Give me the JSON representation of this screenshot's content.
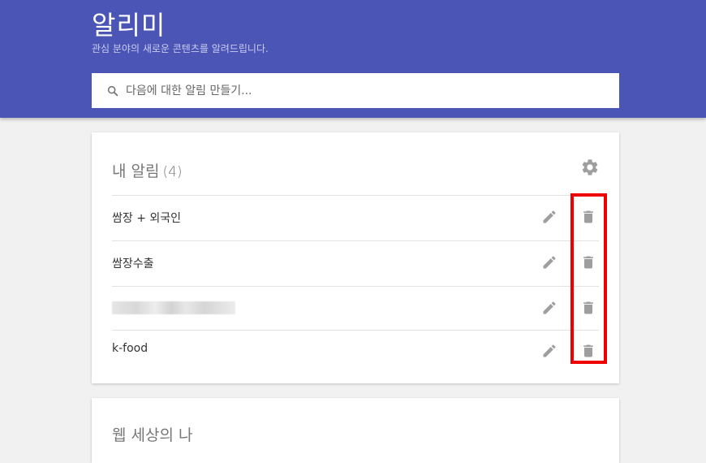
{
  "header": {
    "title": "알리미",
    "subtitle": "관심 분야의 새로운 콘텐츠를 알려드립니다."
  },
  "search": {
    "icon": "search-icon",
    "placeholder": "다음에 대한 알림 만들기..."
  },
  "alerts_card": {
    "title": "내 알림",
    "count": "(4)",
    "settings_icon": "gear-icon",
    "items": [
      {
        "label": "쌈장 + 외국인",
        "redacted": false
      },
      {
        "label": "쌈장수출",
        "redacted": false
      },
      {
        "label": "",
        "redacted": true
      },
      {
        "label": "k-food",
        "redacted": false
      }
    ],
    "edit_icon": "pencil-icon",
    "delete_icon": "trash-icon"
  },
  "web_card": {
    "title": "웹 세상의 나"
  },
  "colors": {
    "header_bg": "#4a55b5",
    "page_bg": "#f1f1f1",
    "highlight": "#ee0000",
    "icon_gray": "#9e9e9e"
  }
}
